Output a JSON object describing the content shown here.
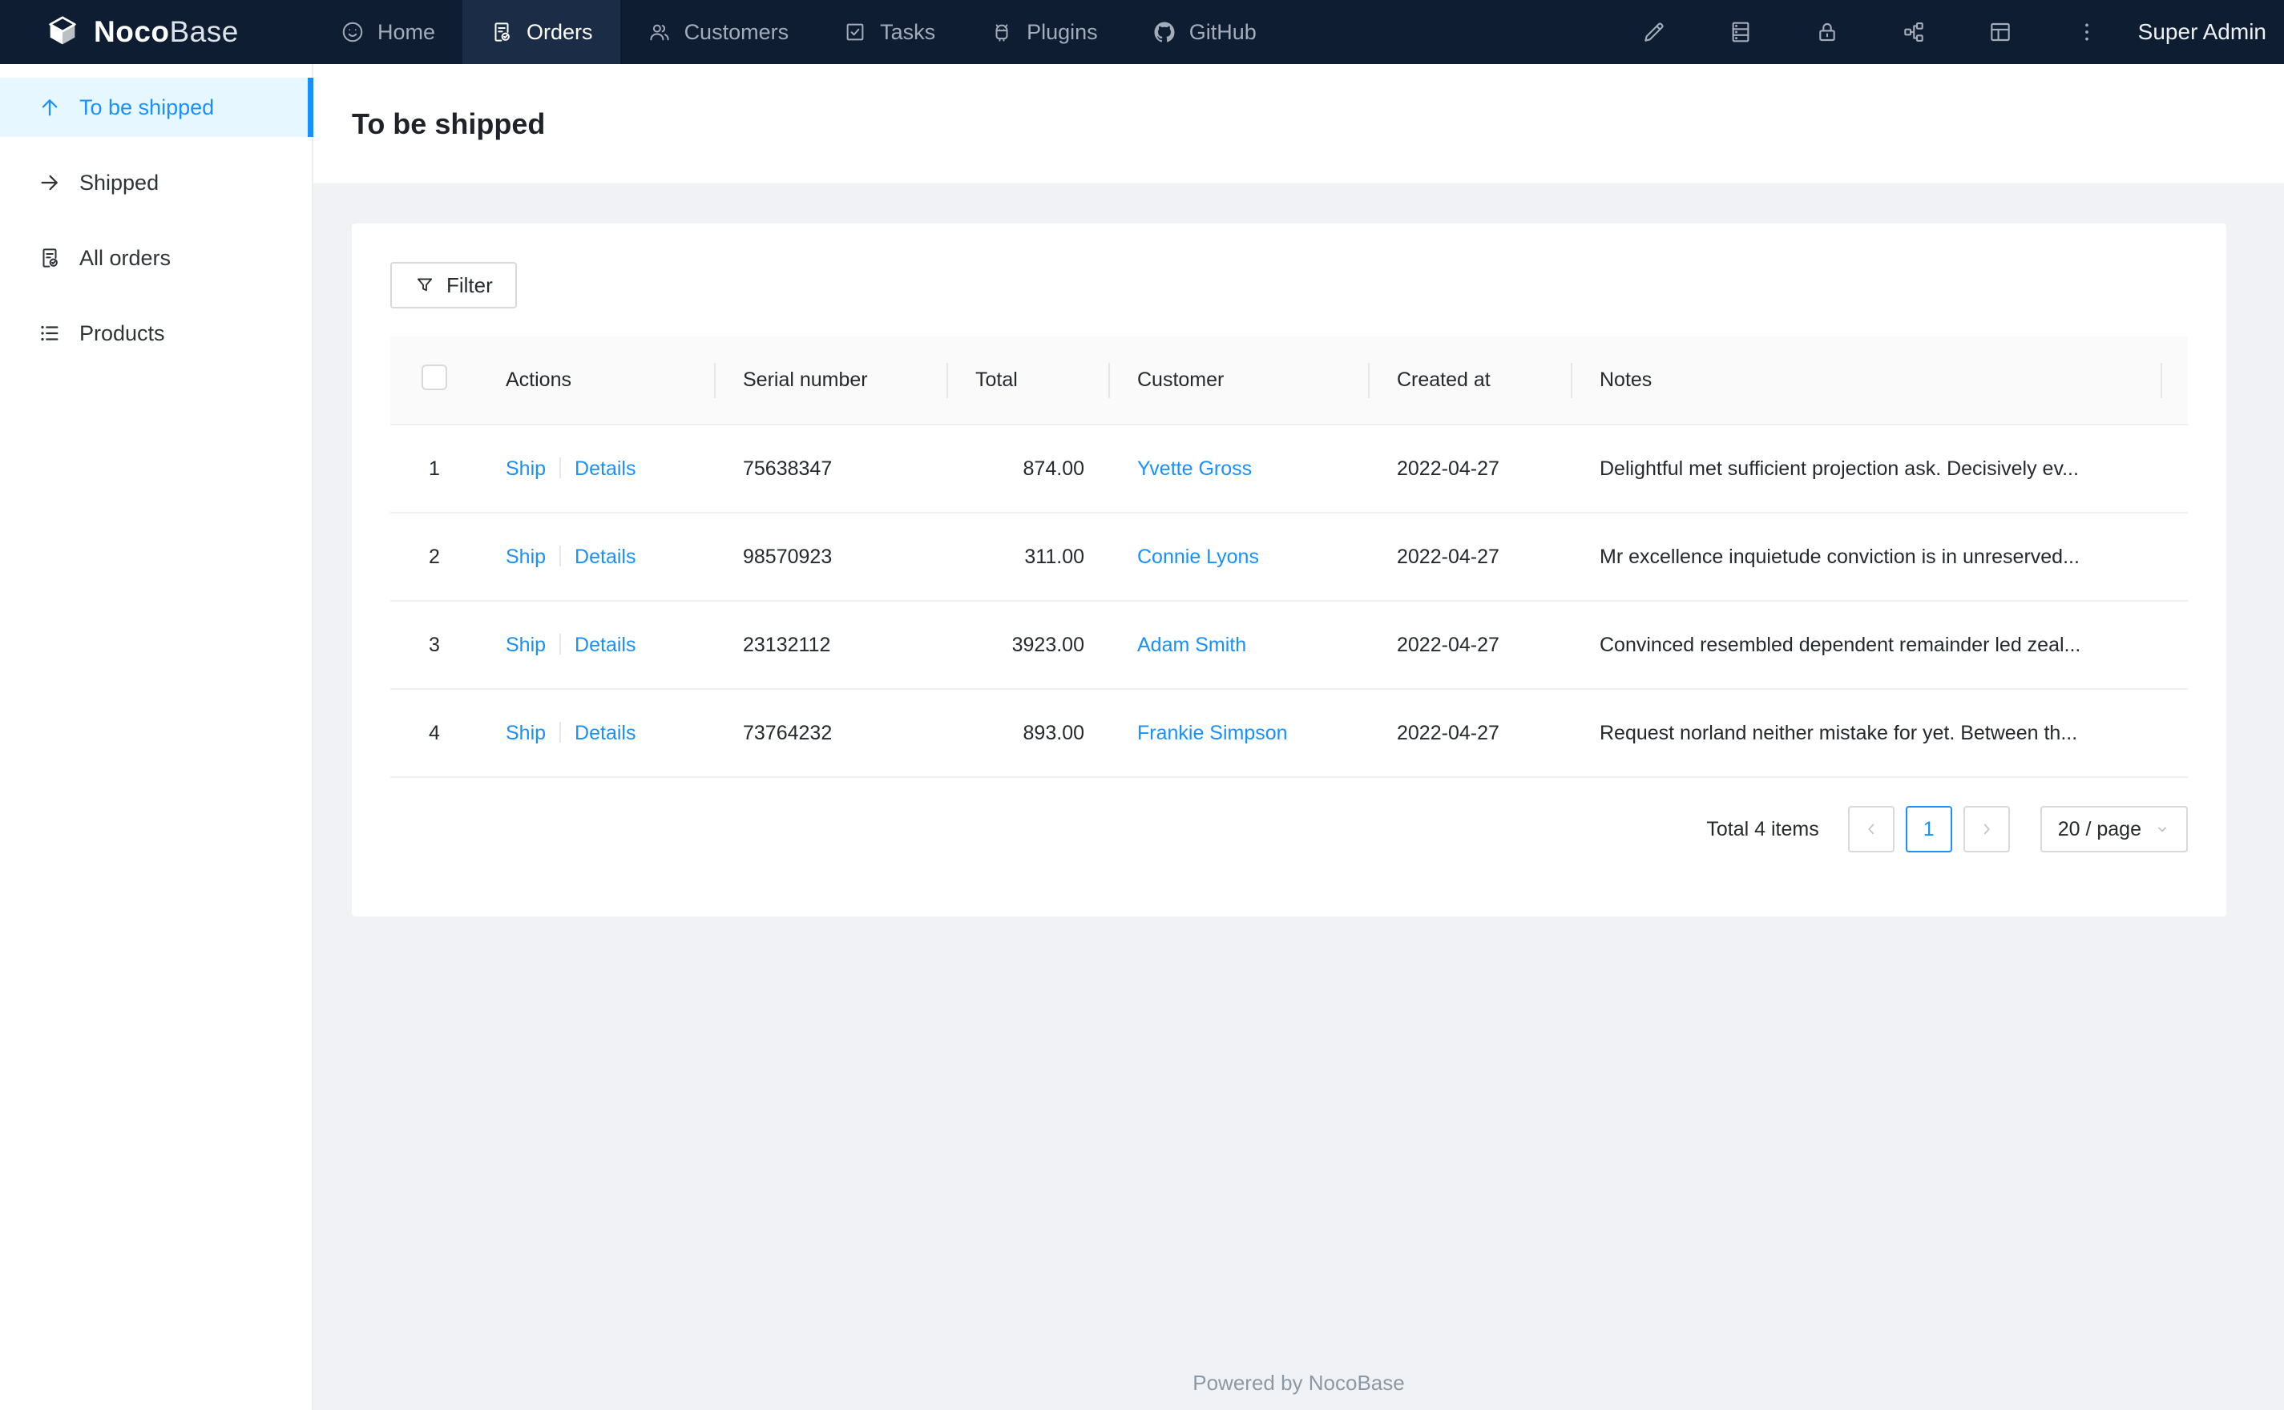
{
  "navbar": {
    "logo": {
      "brand_primary": "Noco",
      "brand_secondary": "Base",
      "icon": "nocobase-logo"
    },
    "items": [
      {
        "label": "Home",
        "icon": "smile-icon",
        "active": false
      },
      {
        "label": "Orders",
        "icon": "file-done-icon",
        "active": true
      },
      {
        "label": "Customers",
        "icon": "team-icon",
        "active": false
      },
      {
        "label": "Tasks",
        "icon": "check-square-icon",
        "active": false
      },
      {
        "label": "Plugins",
        "icon": "android-icon",
        "active": false
      },
      {
        "label": "GitHub",
        "icon": "github-icon",
        "active": false
      }
    ],
    "action_icons": [
      "highlight-icon",
      "database-icon",
      "lock-icon",
      "partition-icon",
      "layout-icon",
      "more-icon"
    ],
    "user": "Super Admin"
  },
  "sidebar": {
    "items": [
      {
        "label": "To be shipped",
        "icon": "arrow-up-icon",
        "active": true
      },
      {
        "label": "Shipped",
        "icon": "arrow-right-icon",
        "active": false
      },
      {
        "label": "All orders",
        "icon": "file-done-icon",
        "active": false
      },
      {
        "label": "Products",
        "icon": "unordered-list-icon",
        "active": false
      }
    ]
  },
  "page": {
    "title": "To be shipped"
  },
  "toolbar": {
    "filter_label": "Filter",
    "filter_icon": "filter-icon"
  },
  "table": {
    "columns": [
      "Actions",
      "Serial number",
      "Total",
      "Customer",
      "Created at",
      "Notes"
    ],
    "rows": [
      {
        "index": "1",
        "actions": [
          "Ship",
          "Details"
        ],
        "serial": "75638347",
        "total": "874.00",
        "customer": "Yvette Gross",
        "created_at": "2022-04-27",
        "notes": "Delightful met sufficient projection ask. Decisively ev..."
      },
      {
        "index": "2",
        "actions": [
          "Ship",
          "Details"
        ],
        "serial": "98570923",
        "total": "311.00",
        "customer": "Connie Lyons",
        "created_at": "2022-04-27",
        "notes": "Mr excellence inquietude conviction is in unreserved..."
      },
      {
        "index": "3",
        "actions": [
          "Ship",
          "Details"
        ],
        "serial": "23132112",
        "total": "3923.00",
        "customer": "Adam Smith",
        "created_at": "2022-04-27",
        "notes": "Convinced resembled dependent remainder led zeal..."
      },
      {
        "index": "4",
        "actions": [
          "Ship",
          "Details"
        ],
        "serial": "73764232",
        "total": "893.00",
        "customer": "Frankie Simpson",
        "created_at": "2022-04-27",
        "notes": "Request norland neither mistake for yet. Between th..."
      }
    ]
  },
  "pagination": {
    "total_text": "Total 4 items",
    "current_page": "1",
    "page_size": "20 / page"
  },
  "footer": {
    "text": "Powered by NocoBase"
  },
  "colors": {
    "accent": "#1890ff",
    "link": "#1890ff",
    "navbar_bg": "#0e1d32",
    "navbar_active_bg": "#1b2c46",
    "sidebar_selected_bg": "#e6f7ff",
    "sidebar_selected_text": "#1890ff",
    "content_bg": "#f0f2f5",
    "table_header_bg": "#fafafa"
  }
}
